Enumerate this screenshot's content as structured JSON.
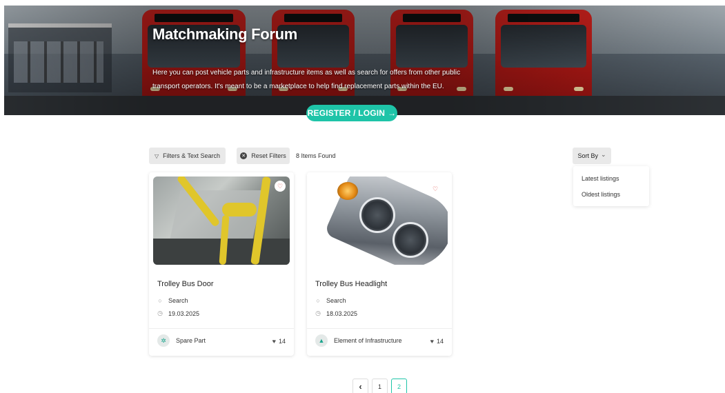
{
  "hero": {
    "title": "Matchmaking Forum",
    "description": "Here you can post vehicle parts and infrastructure items as well as search for offers from other public transport operators. It's meant to be a marketplace to help find replacement parts within the EU.",
    "register_label": "REGISTER / LOGIN",
    "register_arrow": "→"
  },
  "toolbar": {
    "filters_icon": "▽",
    "filters_label": "Filters & Text Search",
    "reset_icon": "✕",
    "reset_label": "Reset Filters",
    "items_found": "8 Items Found",
    "sort_label": "Sort By",
    "sort_chevron": "⌄",
    "sort_options": [
      "Latest listings",
      "Oldest listings"
    ]
  },
  "listings": [
    {
      "title": "Trolley Bus Door",
      "type": "Search",
      "date": "19.03.2025",
      "category": "Spare Part",
      "category_icon": "gear-icon",
      "likes": "14"
    },
    {
      "title": "Trolley Bus Headlight",
      "type": "Search",
      "date": "18.03.2025",
      "category": "Element of Infrastructure",
      "category_icon": "road-icon",
      "likes": "14"
    }
  ],
  "pagination": {
    "prev": "‹",
    "pages": [
      "1",
      "2"
    ],
    "current": "2"
  },
  "colors": {
    "accent": "#1ec4a8",
    "favorite": "#e0413a"
  }
}
